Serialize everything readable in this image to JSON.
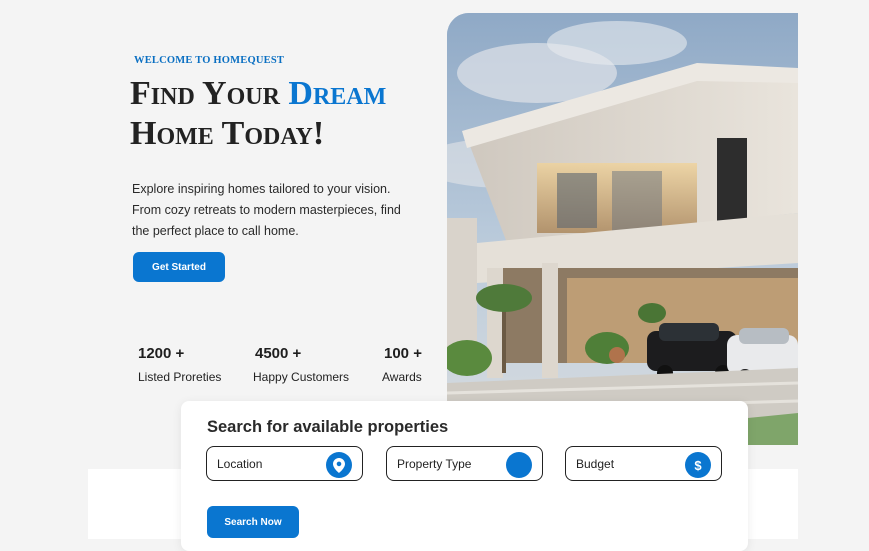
{
  "hero": {
    "kicker": "Welcome to HomeQuest",
    "headline_part1": "Find Your ",
    "headline_accent": "Dream",
    "headline_part2": "Home Today",
    "headline_end": "!",
    "intro": "Explore inspiring homes tailored to your vision. From cozy retreats to modern masterpieces, find the perfect place to call home.",
    "cta_label": "Get Started",
    "image_icon": "modern-house-photo"
  },
  "stats": [
    {
      "value": "1200 +",
      "label": "Listed Proreties"
    },
    {
      "value": "4500 +",
      "label": "Happy Customers"
    },
    {
      "value": "100 +",
      "label": "Awards"
    }
  ],
  "search": {
    "title": "Search for available properties",
    "fields": [
      {
        "label": "Location",
        "icon": "map-pin-icon"
      },
      {
        "label": "Property Type",
        "icon": "blank-circle-icon"
      },
      {
        "label": "Budget",
        "icon": "dollar-icon"
      }
    ],
    "button_label": "Search Now"
  },
  "colors": {
    "accent": "#0a76d0",
    "background": "#f4f4f4",
    "text": "#1e1e1e"
  }
}
